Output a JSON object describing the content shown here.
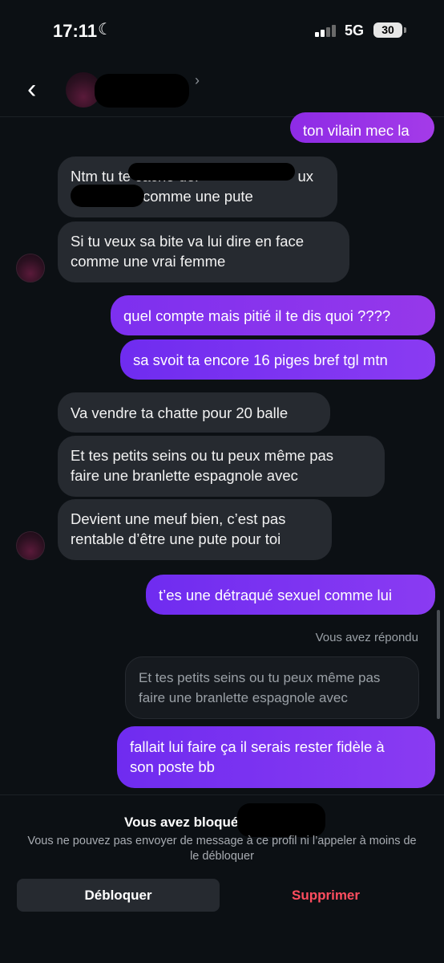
{
  "status_bar": {
    "time": "17:11",
    "network": "5G",
    "battery": "30"
  },
  "header": {
    "contact_name": ""
  },
  "messages": [
    {
      "text": "ton vilain mec la"
    },
    {
      "text": "Ntm tu te cache der… ux … comme une pute"
    },
    {
      "text": "Si tu veux sa bite va lui dire en face comme une vrai femme"
    },
    {
      "text": "quel compte mais pitié il te dis quoi ????"
    },
    {
      "text": "sa svoit ta encore 16 piges bref tgl mtn"
    },
    {
      "text": "Va vendre ta chatte pour 20 balle"
    },
    {
      "text": "Et tes petits seins ou tu peux même pas faire une branlette espagnole avec"
    },
    {
      "text": "Devient une meuf bien, c’est pas rentable d’être une pute pour toi"
    },
    {
      "text": "t’es une détraqué sexuel comme lui"
    },
    {
      "text": "fallait lui faire ça il serais rester fidèle à son poste bb"
    }
  ],
  "message_lines": {
    "m1": "ton vilain mec la",
    "m2a": "Ntm tu te cache der",
    "m2b": "ux",
    "m2c": "comme une pute",
    "m3a": "Si tu veux sa bite va lui dire en face",
    "m3b": "comme une vrai femme",
    "m4": "quel compte mais pitié il te dis quoi ????",
    "m5": "sa svoit ta encore 16 piges bref tgl mtn",
    "m6": "Va vendre ta chatte pour 20 balle",
    "m7a": "Et tes petits seins ou tu peux même pas",
    "m7b": "faire une branlette espagnole avec",
    "m8a": "Devient une meuf bien, c’est pas",
    "m8b": "rentable d’être une pute pour toi",
    "m9": "t’es une détraqué sexuel comme lui",
    "m10a": "fallait lui faire ça il serais rester fidèle à",
    "m10b": "son poste bb"
  },
  "reply": {
    "label": "Vous avez répondu",
    "quoted_line1": "Et tes petits seins ou tu peux même pas",
    "quoted_line2": "faire une branlette espagnole avec"
  },
  "footer": {
    "blocked_title": "Vous avez bloqué",
    "blocked_desc": "Vous ne pouvez pas envoyer de message à ce profil ni l’appeler à moins de le débloquer",
    "unblock_label": "Débloquer",
    "delete_label": "Supprimer"
  },
  "colors": {
    "background": "#0c1014",
    "incoming_bubble": "#262a30",
    "outgoing_bubble": "#7a34f0",
    "delete_red": "#ff4d5f"
  },
  "icons": [
    "moon-icon",
    "signal-icon",
    "battery-icon",
    "back-arrow-icon",
    "chevron-right-icon"
  ]
}
